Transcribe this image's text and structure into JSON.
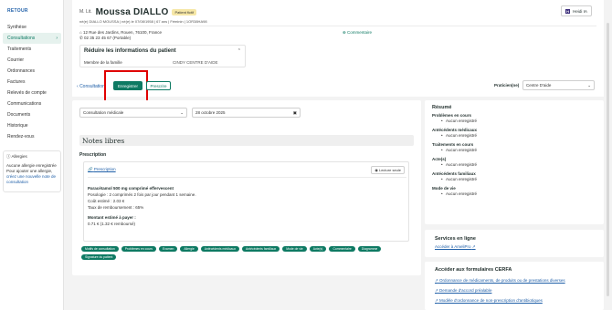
{
  "sidebar": {
    "back_label": "RETOUR",
    "items": [
      {
        "label": "Synthèse"
      },
      {
        "label": "Consultations",
        "chevron": "›"
      },
      {
        "label": "Traitements"
      },
      {
        "label": "Courrier"
      },
      {
        "label": "Ordonnances"
      },
      {
        "label": "Factures"
      },
      {
        "label": "Relevés de compte"
      },
      {
        "label": "Communications"
      },
      {
        "label": "Documents"
      },
      {
        "label": "Historique"
      },
      {
        "label": "Rendez-vous"
      }
    ],
    "allergies": {
      "title": "Allergies",
      "none_text": "Aucune allergie enregistrée",
      "hint_text": "Pour ajouter une allergie,",
      "link_text": "créez une nouvelle note de consultation"
    }
  },
  "patient": {
    "civility": "M. Lit.",
    "name": "Moussa DIALLO",
    "badge": "Patient fictif",
    "meta": "né(e) DIALLO MOUSSA  |  né(e) le 07/08/1958  |  67 ans  |  Féminin  |  1OR38HA98",
    "address": "12 Rue des Jardins, Rouen, 76100, France",
    "phone": "02 35 23 45 67 (Portable)",
    "comment_link": "Commentaire",
    "heidi_label": "Heidi IA"
  },
  "reduce_panel": {
    "title": "Réduire les informations du patient",
    "family_label": "Membre de la famille",
    "family_value": "CINDY CENTRE D'AIDE"
  },
  "action_row": {
    "consult_link": "Consultation",
    "save_label": "Enregistrer",
    "prescribe_label": "Prescrire",
    "practitioner_label": "Praticien(ne)",
    "practitioner_value": "Centre D'aide"
  },
  "consultation": {
    "type_value": "Consultation médicale",
    "date_value": "28 octobre 2025",
    "notes_title": "Notes libres",
    "prescription_label": "Prescription",
    "prescription_link": "Prescription",
    "readonly_badge": "Lecture seule",
    "drug_name": "Paracétamol 500 mg comprimé effervescent",
    "posology": "Posologie : 2 comprimés 2 fois par jour pendant 1 semaine.",
    "cost": "Coût estimé : 2.03 €",
    "reimbursement_rate": "Taux de remboursement : 65%",
    "amount_label": "Montant estimé à payer :",
    "amount_value": "0.71 € (1.32 € remboursé)",
    "chips": [
      "Motifs de consultation",
      "Problèmes en cours",
      "Examen",
      "Allergie",
      "Antécédents médicaux",
      "Antécédents familiaux",
      "Mode de vie",
      "Acte(s)",
      "Commentaire",
      "Diagramme",
      "Signature du patient"
    ]
  },
  "summary": {
    "title": "Résumé",
    "sections": [
      {
        "head": "Problèmes en cours",
        "item": "Aucun enregistré"
      },
      {
        "head": "Antécédents médicaux",
        "item": "Aucun enregistré"
      },
      {
        "head": "Traitements en cours",
        "item": "Aucun enregistré"
      },
      {
        "head": "Acte(s)",
        "item": "Aucun enregistré"
      },
      {
        "head": "Antécédents familiaux",
        "item": "Aucun enregistré"
      },
      {
        "head": "Mode de vie",
        "item": "Aucun enregistré"
      }
    ]
  },
  "services": {
    "title": "Services en ligne",
    "link": "Accéder à AmeliPro"
  },
  "cerfa": {
    "title": "Accéder aux formulaires CERFA",
    "links": [
      "Ordonnance de médicaments, de produits ou de prestations diverses",
      "Demande d'accord préalable",
      "Modèle d'ordonnance de non-prescription d'antibiotiques"
    ]
  }
}
